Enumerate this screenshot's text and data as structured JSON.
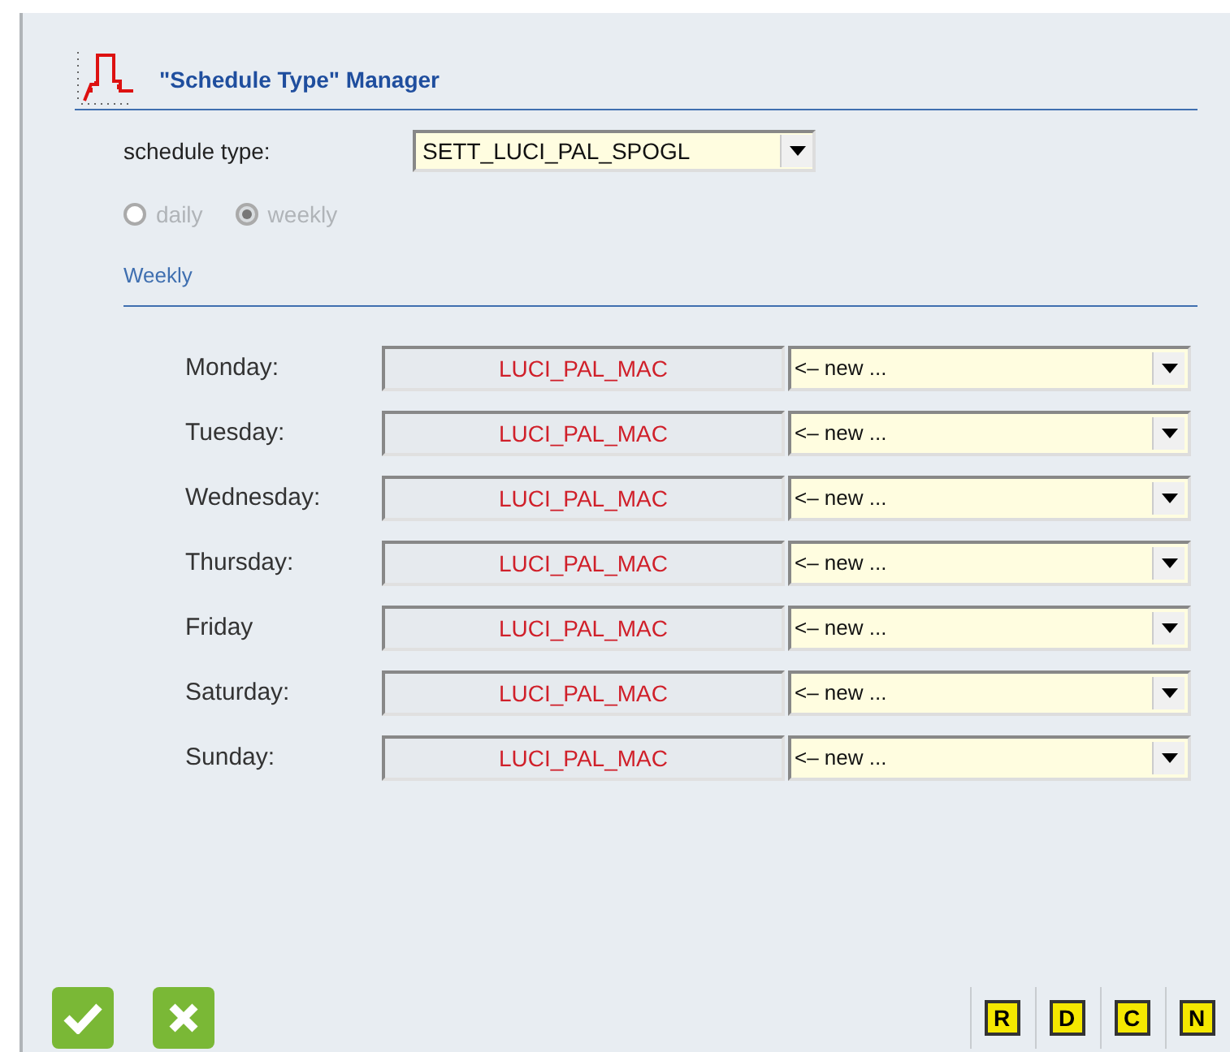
{
  "header": {
    "title": "\"Schedule Type\" Manager"
  },
  "schedule_type": {
    "label": "schedule type:",
    "value": "SETT_LUCI_PAL_SPOGL"
  },
  "mode_options": [
    {
      "label": "daily",
      "selected": false,
      "disabled": true
    },
    {
      "label": "weekly",
      "selected": true,
      "disabled": true
    }
  ],
  "section": {
    "title": "Weekly"
  },
  "days": [
    {
      "label": "Monday:",
      "profile": "LUCI_PAL_MAC",
      "choice": "<– new ..."
    },
    {
      "label": "Tuesday:",
      "profile": "LUCI_PAL_MAC",
      "choice": "<– new ..."
    },
    {
      "label": "Wednesday:",
      "profile": "LUCI_PAL_MAC",
      "choice": "<– new ..."
    },
    {
      "label": "Thursday:",
      "profile": "LUCI_PAL_MAC",
      "choice": "<– new ..."
    },
    {
      "label": "Friday",
      "profile": "LUCI_PAL_MAC",
      "choice": "<– new ..."
    },
    {
      "label": "Saturday:",
      "profile": "LUCI_PAL_MAC",
      "choice": "<– new ..."
    },
    {
      "label": "Sunday:",
      "profile": "LUCI_PAL_MAC",
      "choice": "<– new ..."
    }
  ],
  "action_buttons": [
    {
      "kind": "confirm"
    },
    {
      "kind": "cancel"
    }
  ],
  "letter_buttons": [
    "R",
    "D",
    "C",
    "N"
  ]
}
